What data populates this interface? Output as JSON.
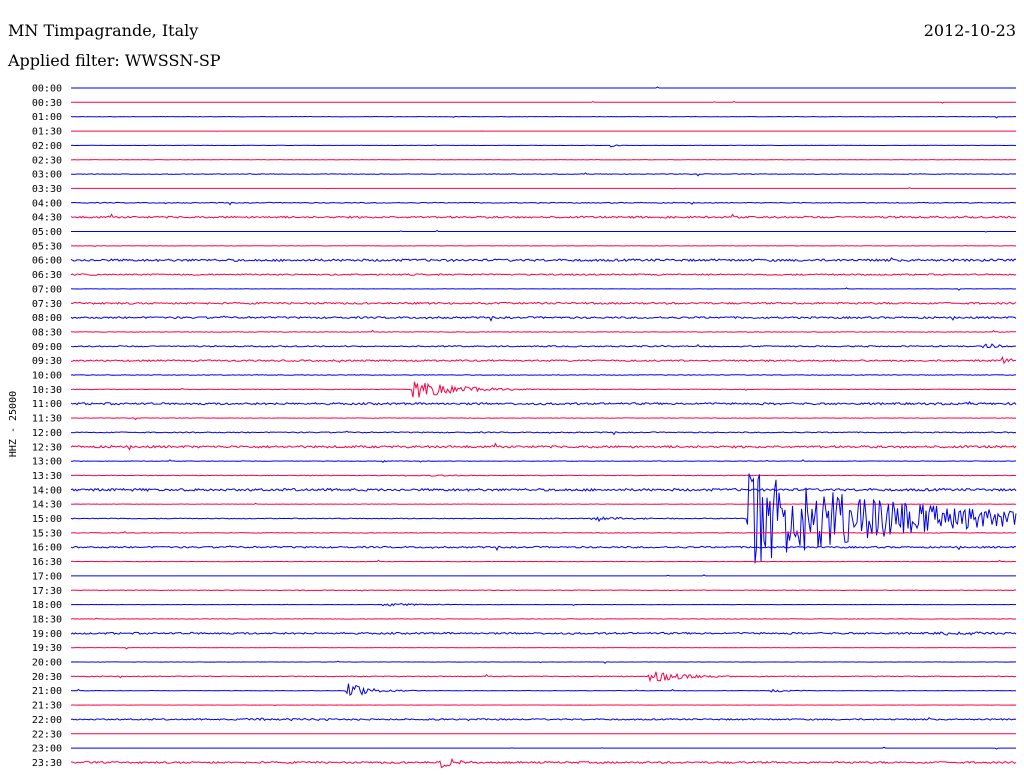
{
  "header": {
    "station": "MN Timpagrande, Italy",
    "date": "2012-10-23",
    "filter": "Applied filter: WWSSN-SP"
  },
  "colors": {
    "blue": "#0000ee",
    "red": "#ff0044",
    "text": "#000000"
  },
  "chart_data": {
    "type": "line",
    "title": "MN Timpagrande, Italy",
    "ylabel": "HHZ - 25000",
    "grid": false,
    "rows": [
      {
        "label": "00:00",
        "color": "blue",
        "noise": 0.0,
        "events": []
      },
      {
        "label": "00:30",
        "color": "red",
        "noise": 0.0,
        "events": []
      },
      {
        "label": "01:00",
        "color": "blue",
        "noise": 0.2,
        "events": []
      },
      {
        "label": "01:30",
        "color": "red",
        "noise": 0.0,
        "events": []
      },
      {
        "label": "02:00",
        "color": "blue",
        "noise": 0.1,
        "events": [
          {
            "t": 0.57,
            "a": 2,
            "d": 0.006
          }
        ]
      },
      {
        "label": "02:30",
        "color": "red",
        "noise": 0.2,
        "events": []
      },
      {
        "label": "03:00",
        "color": "blue",
        "noise": 0.3,
        "events": []
      },
      {
        "label": "03:30",
        "color": "red",
        "noise": 0.0,
        "events": []
      },
      {
        "label": "04:00",
        "color": "blue",
        "noise": 0.4,
        "events": []
      },
      {
        "label": "04:30",
        "color": "red",
        "noise": 0.9,
        "events": []
      },
      {
        "label": "05:00",
        "color": "blue",
        "noise": 0.0,
        "events": []
      },
      {
        "label": "05:30",
        "color": "red",
        "noise": 0.2,
        "events": []
      },
      {
        "label": "06:00",
        "color": "blue",
        "noise": 1.1,
        "events": []
      },
      {
        "label": "06:30",
        "color": "red",
        "noise": 0.7,
        "events": []
      },
      {
        "label": "07:00",
        "color": "blue",
        "noise": 0.1,
        "events": []
      },
      {
        "label": "07:30",
        "color": "red",
        "noise": 0.9,
        "events": []
      },
      {
        "label": "08:00",
        "color": "blue",
        "noise": 0.9,
        "events": []
      },
      {
        "label": "08:30",
        "color": "red",
        "noise": 0.3,
        "events": []
      },
      {
        "label": "09:00",
        "color": "blue",
        "noise": 0.6,
        "events": [
          {
            "t": 0.965,
            "a": 3,
            "d": 0.015
          }
        ]
      },
      {
        "label": "09:30",
        "color": "red",
        "noise": 0.8,
        "events": [
          {
            "t": 0.985,
            "a": 4,
            "d": 0.012
          }
        ]
      },
      {
        "label": "10:00",
        "color": "blue",
        "noise": 0.3,
        "events": []
      },
      {
        "label": "10:30",
        "color": "red",
        "noise": 0.3,
        "events": [
          {
            "t": 0.36,
            "a": 10,
            "d": 0.04
          }
        ]
      },
      {
        "label": "11:00",
        "color": "blue",
        "noise": 1.0,
        "events": []
      },
      {
        "label": "11:30",
        "color": "red",
        "noise": 0.2,
        "events": []
      },
      {
        "label": "12:00",
        "color": "blue",
        "noise": 0.5,
        "events": []
      },
      {
        "label": "12:30",
        "color": "red",
        "noise": 1.1,
        "events": []
      },
      {
        "label": "13:00",
        "color": "blue",
        "noise": 0.2,
        "events": [
          {
            "t": 0.33,
            "a": 2,
            "d": 0.006
          }
        ]
      },
      {
        "label": "13:30",
        "color": "red",
        "noise": 0.3,
        "events": [
          {
            "t": 0.38,
            "a": 1.2,
            "d": 0.02
          }
        ]
      },
      {
        "label": "14:00",
        "color": "blue",
        "noise": 1.2,
        "events": []
      },
      {
        "label": "14:30",
        "color": "red",
        "noise": 0.2,
        "events": []
      },
      {
        "label": "15:00",
        "color": "blue",
        "noise": 0.4,
        "events": [
          {
            "t": 0.55,
            "a": 1.5,
            "d": 0.06
          },
          {
            "t": 0.715,
            "a": 48,
            "d": 0.15
          }
        ]
      },
      {
        "label": "15:30",
        "color": "red",
        "noise": 0.3,
        "events": []
      },
      {
        "label": "16:00",
        "color": "blue",
        "noise": 0.8,
        "events": []
      },
      {
        "label": "16:30",
        "color": "red",
        "noise": 0.2,
        "events": []
      },
      {
        "label": "17:00",
        "color": "blue",
        "noise": 0.0,
        "events": []
      },
      {
        "label": "17:30",
        "color": "red",
        "noise": 0.3,
        "events": []
      },
      {
        "label": "18:00",
        "color": "blue",
        "noise": 0.1,
        "events": [
          {
            "t": 0.33,
            "a": 1.5,
            "d": 0.04
          }
        ]
      },
      {
        "label": "18:30",
        "color": "red",
        "noise": 0.2,
        "events": []
      },
      {
        "label": "19:00",
        "color": "blue",
        "noise": 0.9,
        "events": [
          {
            "t": 0.92,
            "a": 1.5,
            "d": 0.04
          }
        ]
      },
      {
        "label": "19:30",
        "color": "red",
        "noise": 0.1,
        "events": []
      },
      {
        "label": "20:00",
        "color": "blue",
        "noise": 0.1,
        "events": []
      },
      {
        "label": "20:30",
        "color": "red",
        "noise": 0.4,
        "events": [
          {
            "t": 0.61,
            "a": 7,
            "d": 0.03
          }
        ]
      },
      {
        "label": "21:00",
        "color": "blue",
        "noise": 0.2,
        "events": [
          {
            "t": 0.29,
            "a": 9,
            "d": 0.02
          },
          {
            "t": 0.74,
            "a": 1.5,
            "d": 0.02
          }
        ]
      },
      {
        "label": "21:30",
        "color": "red",
        "noise": 0.1,
        "events": []
      },
      {
        "label": "22:00",
        "color": "blue",
        "noise": 0.7,
        "events": [
          {
            "t": 0.18,
            "a": 1.5,
            "d": 0.05
          }
        ]
      },
      {
        "label": "22:30",
        "color": "red",
        "noise": 0.0,
        "events": []
      },
      {
        "label": "23:00",
        "color": "blue",
        "noise": 0.0,
        "events": []
      },
      {
        "label": "23:30",
        "color": "red",
        "noise": 0.9,
        "events": [
          {
            "t": 0.39,
            "a": 6,
            "d": 0.015
          }
        ]
      }
    ]
  }
}
